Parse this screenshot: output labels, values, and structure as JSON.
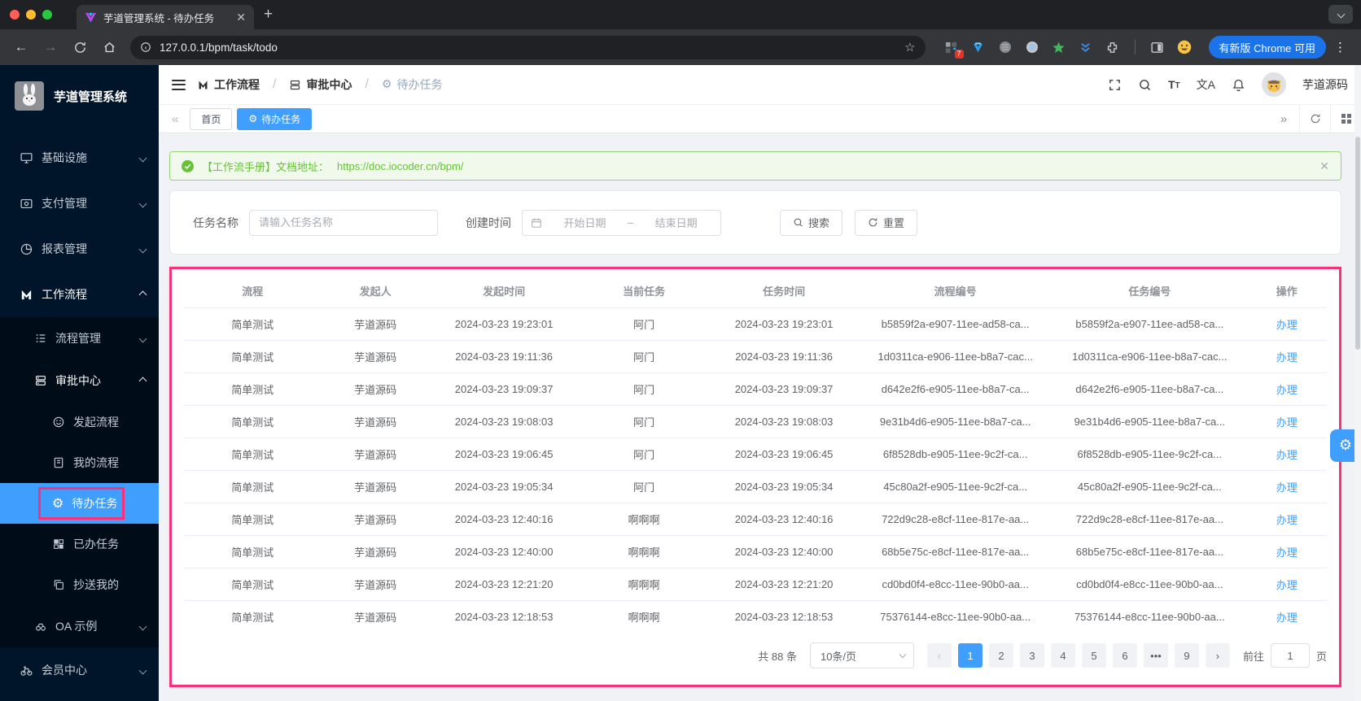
{
  "browser": {
    "tab_title": "芋道管理系统 - 待办任务",
    "url": "127.0.0.1/bpm/task/todo",
    "extension_badge": "7",
    "update_button": "有新版 Chrome 可用"
  },
  "sidebar": {
    "title": "芋道管理系统",
    "items": [
      {
        "label": "基础设施"
      },
      {
        "label": "支付管理"
      },
      {
        "label": "报表管理"
      },
      {
        "label": "工作流程"
      },
      {
        "label": "流程管理"
      },
      {
        "label": "审批中心"
      },
      {
        "label": "发起流程"
      },
      {
        "label": "我的流程"
      },
      {
        "label": "待办任务"
      },
      {
        "label": "已办任务"
      },
      {
        "label": "抄送我的"
      },
      {
        "label": "OA 示例"
      },
      {
        "label": "会员中心"
      }
    ]
  },
  "header": {
    "breadcrumb": [
      {
        "label": "工作流程"
      },
      {
        "label": "审批中心"
      },
      {
        "label": "待办任务"
      }
    ],
    "font_icon_label": "T",
    "locale_icon_label": "文A",
    "username": "芋道源码"
  },
  "tabbar": {
    "tabs": [
      {
        "label": "首页"
      },
      {
        "label": "待办任务"
      }
    ]
  },
  "alert": {
    "text": "【工作流手册】文档地址：",
    "link": "https://doc.iocoder.cn/bpm/"
  },
  "filters": {
    "task_name_label": "任务名称",
    "task_name_placeholder": "请输入任务名称",
    "create_time_label": "创建时间",
    "start_placeholder": "开始日期",
    "range_separator": "–",
    "end_placeholder": "结束日期",
    "search_label": "搜索",
    "reset_label": "重置"
  },
  "table": {
    "columns": [
      "流程",
      "发起人",
      "发起时间",
      "当前任务",
      "任务时间",
      "流程编号",
      "任务编号",
      "操作"
    ],
    "rows": [
      {
        "process": "简单测试",
        "starter": "芋道源码",
        "start_time": "2024-03-23 19:23:01",
        "current_task": "阿门",
        "task_time": "2024-03-23 19:23:01",
        "process_no": "b5859f2a-e907-11ee-ad58-ca...",
        "task_no": "b5859f2a-e907-11ee-ad58-ca...",
        "action": "办理"
      },
      {
        "process": "简单测试",
        "starter": "芋道源码",
        "start_time": "2024-03-23 19:11:36",
        "current_task": "阿门",
        "task_time": "2024-03-23 19:11:36",
        "process_no": "1d0311ca-e906-11ee-b8a7-cac...",
        "task_no": "1d0311ca-e906-11ee-b8a7-cac...",
        "action": "办理"
      },
      {
        "process": "简单测试",
        "starter": "芋道源码",
        "start_time": "2024-03-23 19:09:37",
        "current_task": "阿门",
        "task_time": "2024-03-23 19:09:37",
        "process_no": "d642e2f6-e905-11ee-b8a7-ca...",
        "task_no": "d642e2f6-e905-11ee-b8a7-ca...",
        "action": "办理"
      },
      {
        "process": "简单测试",
        "starter": "芋道源码",
        "start_time": "2024-03-23 19:08:03",
        "current_task": "阿门",
        "task_time": "2024-03-23 19:08:03",
        "process_no": "9e31b4d6-e905-11ee-b8a7-ca...",
        "task_no": "9e31b4d6-e905-11ee-b8a7-ca...",
        "action": "办理"
      },
      {
        "process": "简单测试",
        "starter": "芋道源码",
        "start_time": "2024-03-23 19:06:45",
        "current_task": "阿门",
        "task_time": "2024-03-23 19:06:45",
        "process_no": "6f8528db-e905-11ee-9c2f-ca...",
        "task_no": "6f8528db-e905-11ee-9c2f-ca...",
        "action": "办理"
      },
      {
        "process": "简单测试",
        "starter": "芋道源码",
        "start_time": "2024-03-23 19:05:34",
        "current_task": "阿门",
        "task_time": "2024-03-23 19:05:34",
        "process_no": "45c80a2f-e905-11ee-9c2f-ca...",
        "task_no": "45c80a2f-e905-11ee-9c2f-ca...",
        "action": "办理"
      },
      {
        "process": "简单测试",
        "starter": "芋道源码",
        "start_time": "2024-03-23 12:40:16",
        "current_task": "啊啊啊",
        "task_time": "2024-03-23 12:40:16",
        "process_no": "722d9c28-e8cf-11ee-817e-aa...",
        "task_no": "722d9c28-e8cf-11ee-817e-aa...",
        "action": "办理"
      },
      {
        "process": "简单测试",
        "starter": "芋道源码",
        "start_time": "2024-03-23 12:40:00",
        "current_task": "啊啊啊",
        "task_time": "2024-03-23 12:40:00",
        "process_no": "68b5e75c-e8cf-11ee-817e-aa...",
        "task_no": "68b5e75c-e8cf-11ee-817e-aa...",
        "action": "办理"
      },
      {
        "process": "简单测试",
        "starter": "芋道源码",
        "start_time": "2024-03-23 12:21:20",
        "current_task": "啊啊啊",
        "task_time": "2024-03-23 12:21:20",
        "process_no": "cd0bd0f4-e8cc-11ee-90b0-aa...",
        "task_no": "cd0bd0f4-e8cc-11ee-90b0-aa...",
        "action": "办理"
      },
      {
        "process": "简单测试",
        "starter": "芋道源码",
        "start_time": "2024-03-23 12:18:53",
        "current_task": "啊啊啊",
        "task_time": "2024-03-23 12:18:53",
        "process_no": "75376144-e8cc-11ee-90b0-aa...",
        "task_no": "75376144-e8cc-11ee-90b0-aa...",
        "action": "办理"
      }
    ]
  },
  "pagination": {
    "total": "共 88 条",
    "page_size": "10条/页",
    "prev_glyph": "‹",
    "next_glyph": "›",
    "pages": [
      "1",
      "2",
      "3",
      "4",
      "5",
      "6",
      "•••",
      "9"
    ],
    "active_page": "1",
    "goto_label": "前往",
    "goto_value": "1",
    "unit_label": "页"
  },
  "colors": {
    "primary": "#409eff",
    "annotation_pink": "#f5327b",
    "success_green": "#67c23a",
    "sidebar_bg": "#001529",
    "chrome_update_blue": "#1a73e8"
  }
}
